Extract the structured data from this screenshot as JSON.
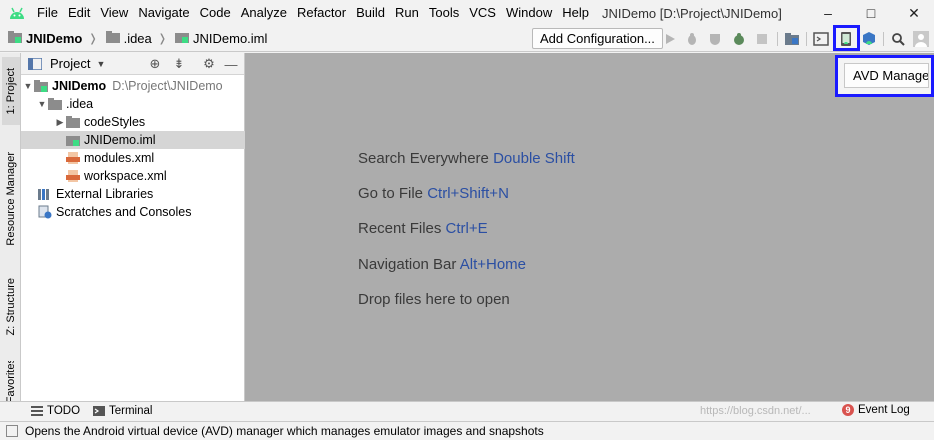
{
  "menubar": {
    "items": [
      {
        "label": "File"
      },
      {
        "label": "Edit"
      },
      {
        "label": "View"
      },
      {
        "label": "Navigate"
      },
      {
        "label": "Code"
      },
      {
        "label": "Analyze"
      },
      {
        "label": "Refactor"
      },
      {
        "label": "Build"
      },
      {
        "label": "Run"
      },
      {
        "label": "Tools"
      },
      {
        "label": "VCS"
      },
      {
        "label": "Window"
      },
      {
        "label": "Help"
      }
    ],
    "window_title": "JNIDemo [D:\\Project\\JNIDemo]",
    "minimize": "–",
    "maximize": "□",
    "close": "✕"
  },
  "navbar": {
    "breadcrumbs": [
      "JNIDemo",
      ".idea",
      "JNIDemo.iml"
    ],
    "add_configuration": "Add Configuration...",
    "toolbar_icons": [
      "run-icon",
      "debug-icon",
      "coverage-icon",
      "apply-changes-icon",
      "stop-icon",
      "project-structure-icon",
      "terminal-icon",
      "avd-manager-icon",
      "sdk-manager-icon",
      "search-icon",
      "avatar-icon"
    ]
  },
  "left_strip": {
    "tabs": [
      {
        "label": "1: Project",
        "active": true
      },
      {
        "label": "Resource Manager"
      },
      {
        "label": "Z: Structure"
      },
      {
        "label": "Favorites"
      }
    ]
  },
  "project_panel": {
    "title": "Project",
    "tree": [
      {
        "label": "JNIDemo",
        "path": "D:\\Project\\JNIDemo",
        "bold": true
      },
      {
        "label": ".idea"
      },
      {
        "label": "codeStyles"
      },
      {
        "label": "JNIDemo.iml",
        "selected": true
      },
      {
        "label": "modules.xml"
      },
      {
        "label": "workspace.xml"
      },
      {
        "label": "External Libraries"
      },
      {
        "label": "Scratches and Consoles"
      }
    ]
  },
  "editor": {
    "hints": [
      {
        "text": "Search Everywhere",
        "key": "Double Shift"
      },
      {
        "text": "Go to File",
        "key": "Ctrl+Shift+N"
      },
      {
        "text": "Recent Files",
        "key": "Ctrl+E"
      },
      {
        "text": "Navigation Bar",
        "key": "Alt+Home"
      },
      {
        "text": "Drop files here to open",
        "key": ""
      }
    ]
  },
  "tooltip": {
    "label": "AVD Manager"
  },
  "bottom_tools": {
    "todo": "TODO",
    "terminal": "Terminal",
    "event_log": "Event Log",
    "event_count": "9"
  },
  "statusbar": {
    "text": "Opens the Android virtual device (AVD) manager which manages emulator images and snapshots",
    "watermark": "https://blog.csdn.net/..."
  },
  "colors": {
    "highlight": "#1a1aff",
    "shortcut": "#2b4fa3",
    "editor_bg": "#acacac"
  }
}
